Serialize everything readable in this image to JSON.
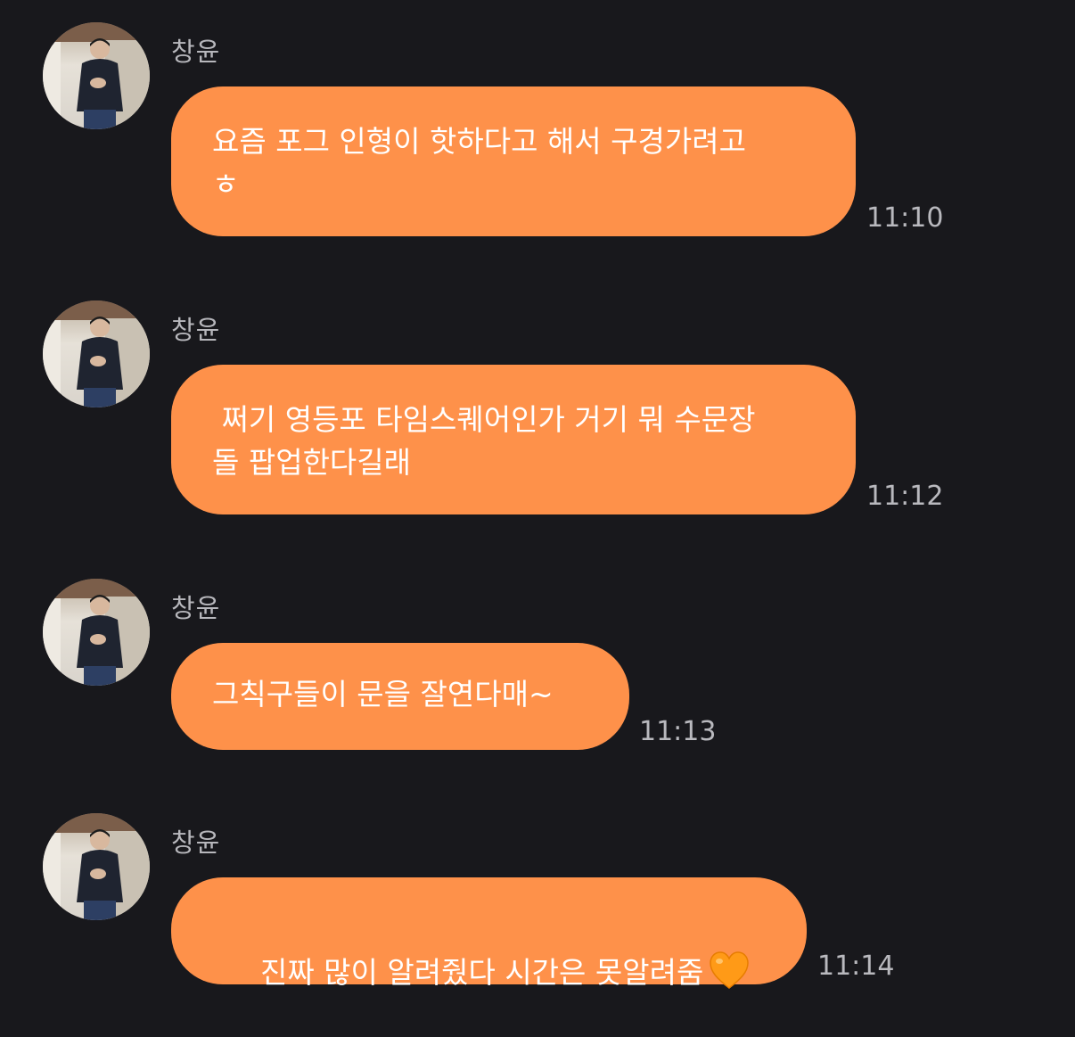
{
  "messages": [
    {
      "sender": "창윤",
      "text": "요즘 포그 인형이 핫하다고 해서 구경가려고\nㅎ",
      "time": "11:10"
    },
    {
      "sender": "창윤",
      "text": " 쩌기 영등포 타임스퀘어인가 거기 뭐 수문장\n돌 팝업한다길래",
      "time": "11:12"
    },
    {
      "sender": "창윤",
      "text": "그칙구들이 문을 잘연다매~",
      "time": "11:13"
    },
    {
      "sender": "창윤",
      "text": "진짜 많이 알려줬다 시간은 못알려줌",
      "time": "11:14",
      "emoji": "orange-heart"
    }
  ],
  "colors": {
    "background": "#18181c",
    "bubble": "#fe914a",
    "bubble_text": "#ffffff",
    "sender_text": "#b7b7bc",
    "time_text": "#b9b9be"
  }
}
